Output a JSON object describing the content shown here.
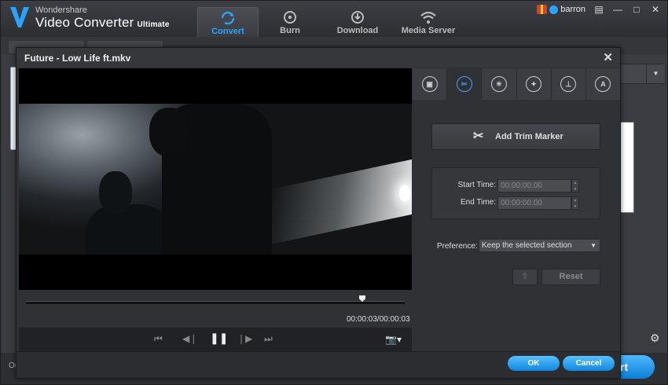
{
  "app": {
    "brand_top": "Wondershare",
    "brand_main": "Video Converter",
    "brand_ultimate": "Ultimate",
    "tabs": [
      {
        "label": "Convert",
        "icon": "convert-icon"
      },
      {
        "label": "Burn",
        "icon": "burn-icon"
      },
      {
        "label": "Download",
        "icon": "download-icon"
      },
      {
        "label": "Media Server",
        "icon": "wifi-icon"
      }
    ],
    "username": "barron",
    "start_label": "rt",
    "bottom_left": "Ou"
  },
  "dialog": {
    "title": "Future - Low Life ft.mkv",
    "time_readout": "00:00:03/00:00:03",
    "playback_position": 0.89,
    "tool_icons": [
      "video-effect-icon",
      "trim-icon",
      "brightness-icon",
      "magic-icon",
      "watermark-icon",
      "subtitle-icon"
    ],
    "add_trim_marker": "Add Trim Marker",
    "start_time_label": "Start Time:",
    "start_time_value": "00:00:00.00",
    "end_time_label": "End Time:",
    "end_time_value": "00:00:00.00",
    "preference_label": "Preference:",
    "preference_value": "Keep the selected section",
    "reset_label": "Reset",
    "ok_label": "OK",
    "cancel_label": "Cancel"
  },
  "colors": {
    "accent": "#2aa3ff",
    "button_blue": "#0e86e0",
    "dialog_bg": "#2f3135"
  }
}
